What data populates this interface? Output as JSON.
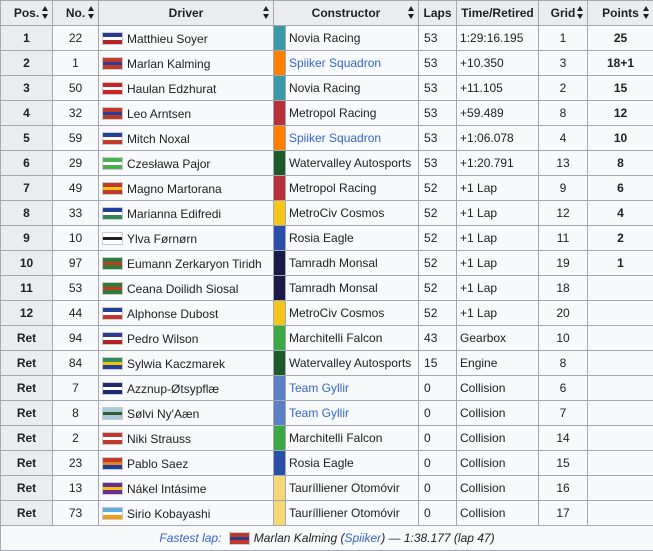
{
  "headers": {
    "pos": "Pos.",
    "no": "No.",
    "driver": "Driver",
    "constructor": "Constructor",
    "laps": "Laps",
    "time": "Time/Retired",
    "grid": "Grid",
    "points": "Points"
  },
  "rows": [
    {
      "pos": "1",
      "no": "22",
      "driver": "Matthieu Soyer",
      "flag": [
        "#2d3a8c",
        "#ffffff",
        "#b22222"
      ],
      "color": "#3a9aa8",
      "constructor": "Novia Racing",
      "link": false,
      "laps": "53",
      "time": "1:29:16.195",
      "grid": "1",
      "points": "25"
    },
    {
      "pos": "2",
      "no": "1",
      "driver": "Marlan Kalming",
      "flag": [
        "#c0392b",
        "#2c3e8f",
        "#c0392b"
      ],
      "color": "#ff8000",
      "constructor": "Spiiker Squadron",
      "link": true,
      "laps": "53",
      "time": "+10.350",
      "grid": "3",
      "points": "18+1"
    },
    {
      "pos": "3",
      "no": "50",
      "driver": "Haulan Edzhurat",
      "flag": [
        "#cc2222",
        "#ffffff",
        "#cc2222"
      ],
      "color": "#3a9aa8",
      "constructor": "Novia Racing",
      "link": false,
      "laps": "53",
      "time": "+11.105",
      "grid": "2",
      "points": "15"
    },
    {
      "pos": "4",
      "no": "32",
      "driver": "Leo Arntsen",
      "flag": [
        "#c0392b",
        "#1f3f99",
        "#c0392b"
      ],
      "color": "#b8303a",
      "constructor": "Metropol Racing",
      "link": false,
      "laps": "53",
      "time": "+59.489",
      "grid": "8",
      "points": "12"
    },
    {
      "pos": "5",
      "no": "59",
      "driver": "Mitch Noxal",
      "flag": [
        "#1f3f99",
        "#ffffff",
        "#c0392b"
      ],
      "color": "#ff8000",
      "constructor": "Spiiker Squadron",
      "link": true,
      "laps": "53",
      "time": "+1:06.078",
      "grid": "4",
      "points": "10"
    },
    {
      "pos": "6",
      "no": "29",
      "driver": "Czesława Pajor",
      "flag": [
        "#4caf50",
        "#ffffff",
        "#4caf50"
      ],
      "color": "#1d5a2a",
      "constructor": "Watervalley Autosports",
      "link": false,
      "laps": "53",
      "time": "+1:20.791",
      "grid": "13",
      "points": "8"
    },
    {
      "pos": "7",
      "no": "49",
      "driver": "Magno Martorana",
      "flag": [
        "#c0392b",
        "#f1c40f",
        "#c0392b"
      ],
      "color": "#b8303a",
      "constructor": "Metropol Racing",
      "link": false,
      "laps": "52",
      "time": "+1 Lap",
      "grid": "9",
      "points": "6"
    },
    {
      "pos": "8",
      "no": "33",
      "driver": "Marianna Edifredi",
      "flag": [
        "#1f3f99",
        "#ffffff",
        "#2e8b57"
      ],
      "color": "#f5c518",
      "constructor": "MetroCiv Cosmos",
      "link": false,
      "laps": "52",
      "time": "+1 Lap",
      "grid": "12",
      "points": "4"
    },
    {
      "pos": "9",
      "no": "10",
      "driver": "Ylva Førnørn",
      "flag": [
        "#ffffff",
        "#222222",
        "#ffffff"
      ],
      "color": "#2b4ea8",
      "constructor": "Rosia Eagle",
      "link": false,
      "laps": "52",
      "time": "+1 Lap",
      "grid": "11",
      "points": "2"
    },
    {
      "pos": "10",
      "no": "97",
      "driver": "Eumann Zerkaryon Tiridh",
      "flag": [
        "#2e7d32",
        "#c0392b",
        "#2e7d32"
      ],
      "color": "#1a1a4a",
      "constructor": "Tamradh Monsal",
      "link": false,
      "laps": "52",
      "time": "+1 Lap",
      "grid": "19",
      "points": "1"
    },
    {
      "pos": "11",
      "no": "53",
      "driver": "Ceana Doilidh Siosal",
      "flag": [
        "#2e7d32",
        "#c0392b",
        "#2e7d32"
      ],
      "color": "#1a1a4a",
      "constructor": "Tamradh Monsal",
      "link": false,
      "laps": "52",
      "time": "+1 Lap",
      "grid": "18",
      "points": ""
    },
    {
      "pos": "12",
      "no": "44",
      "driver": "Alphonse Dubost",
      "flag": [
        "#1f3f99",
        "#ffffff",
        "#c0392b"
      ],
      "color": "#f5c518",
      "constructor": "MetroCiv Cosmos",
      "link": false,
      "laps": "52",
      "time": "+1 Lap",
      "grid": "20",
      "points": ""
    },
    {
      "pos": "Ret",
      "no": "94",
      "driver": "Pedro Wilson",
      "flag": [
        "#2d3a8c",
        "#ffffff",
        "#b22222"
      ],
      "color": "#3ba845",
      "constructor": "Marchitelli Falcon",
      "link": false,
      "laps": "43",
      "time": "Gearbox",
      "grid": "10",
      "points": ""
    },
    {
      "pos": "Ret",
      "no": "84",
      "driver": "Sylwia Kaczmarek",
      "flag": [
        "#2e8b57",
        "#f1c40f",
        "#1f3f99"
      ],
      "color": "#1d5a2a",
      "constructor": "Watervalley Autosports",
      "link": false,
      "laps": "15",
      "time": "Engine",
      "grid": "8",
      "points": ""
    },
    {
      "pos": "Ret",
      "no": "7",
      "driver": "Azznup-Øtsypflæ",
      "flag": [
        "#1a2a6c",
        "#ffffff",
        "#1a2a6c"
      ],
      "color": "#5b7fc4",
      "constructor": "Team Gyllir",
      "link": true,
      "laps": "0",
      "time": "Collision",
      "grid": "6",
      "points": ""
    },
    {
      "pos": "Ret",
      "no": "8",
      "driver": "Sølvi Ny'Aæn",
      "flag": [
        "#a9c9d9",
        "#2e5e2e",
        "#a9c9d9"
      ],
      "color": "#5b7fc4",
      "constructor": "Team Gyllir",
      "link": true,
      "laps": "0",
      "time": "Collision",
      "grid": "7",
      "points": ""
    },
    {
      "pos": "Ret",
      "no": "2",
      "driver": "Niki Strauss",
      "flag": [
        "#c0392b",
        "#ffffff",
        "#c0392b"
      ],
      "color": "#3ba845",
      "constructor": "Marchitelli Falcon",
      "link": false,
      "laps": "0",
      "time": "Collision",
      "grid": "14",
      "points": ""
    },
    {
      "pos": "Ret",
      "no": "23",
      "driver": "Pablo Saez",
      "flag": [
        "#c0392b",
        "#e67e22",
        "#1f3f99"
      ],
      "color": "#2b4ea8",
      "constructor": "Rosia Eagle",
      "link": false,
      "laps": "0",
      "time": "Collision",
      "grid": "15",
      "points": ""
    },
    {
      "pos": "Ret",
      "no": "13",
      "driver": "Nákel Intásime",
      "flag": [
        "#6a2c91",
        "#f1c40f",
        "#6a2c91"
      ],
      "color": "#f7d774",
      "constructor": "Taurílliener Otomóvir",
      "link": false,
      "laps": "0",
      "time": "Collision",
      "grid": "16",
      "points": ""
    },
    {
      "pos": "Ret",
      "no": "73",
      "driver": "Sirio Kobayashi",
      "flag": [
        "#5dade2",
        "#ffffff",
        "#f39c12"
      ],
      "color": "#f7d774",
      "constructor": "Taurílliener Otomóvir",
      "link": false,
      "laps": "0",
      "time": "Collision",
      "grid": "17",
      "points": ""
    }
  ],
  "footer": {
    "label": "Fastest lap:",
    "driver": "Marlan Kalming",
    "team": "Spiiker",
    "detail": " — 1:38.177 (lap 47)",
    "flag": [
      "#c0392b",
      "#2c3e8f",
      "#c0392b"
    ]
  },
  "icons": {
    "sort": "sort-arrows-icon"
  }
}
